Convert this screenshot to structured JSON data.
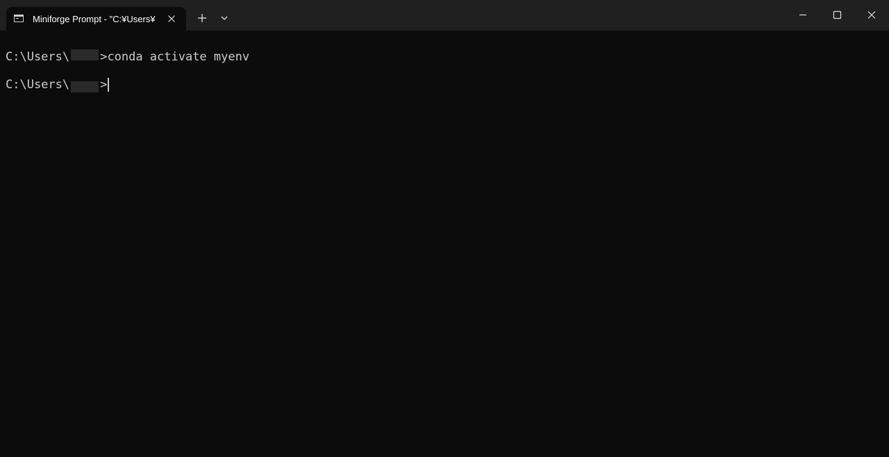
{
  "tab": {
    "title": "Miniforge Prompt - \"C:¥Users¥",
    "icon": "terminal-icon"
  },
  "toolbar": {
    "new_tab_icon": "plus-icon",
    "dropdown_icon": "chevron-down-icon"
  },
  "window_controls": {
    "minimize_icon": "minimize-icon",
    "maximize_icon": "maximize-icon",
    "close_icon": "close-icon"
  },
  "terminal": {
    "lines": [
      {
        "prompt_prefix": "C:\\Users\\",
        "prompt_suffix": ">",
        "command": "conda activate myenv"
      },
      {
        "prompt_prefix": "C:\\Users\\",
        "prompt_suffix": ">",
        "command": ""
      }
    ]
  },
  "colors": {
    "background": "#0c0c0c",
    "titlebar": "#202020",
    "text": "#cccccc"
  }
}
